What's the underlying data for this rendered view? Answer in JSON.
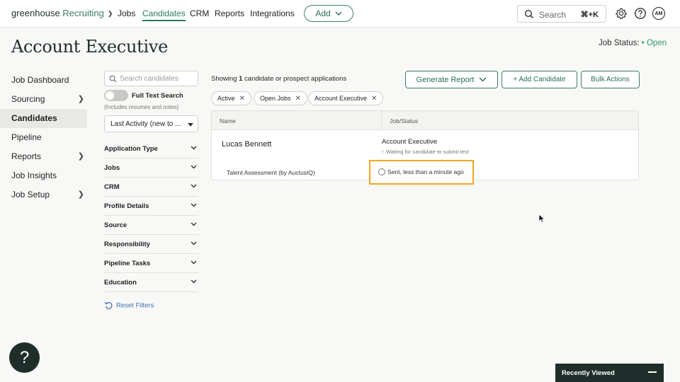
{
  "topnav": {
    "logo_main": "greenhouse",
    "logo_sub": "Recruiting",
    "links": [
      "Jobs",
      "Candidates",
      "CRM",
      "Reports",
      "Integrations"
    ],
    "active_link": "Candidates",
    "add_label": "Add",
    "search_label": "Search",
    "search_shortcut": "⌘+K",
    "avatar_initials": "AM"
  },
  "header": {
    "title": "Account Executive",
    "job_status_label": "Job Status:",
    "job_status_value": "Open"
  },
  "leftnav": {
    "items": [
      {
        "label": "Job Dashboard",
        "has_chevron": false
      },
      {
        "label": "Sourcing",
        "has_chevron": true
      },
      {
        "label": "Candidates",
        "has_chevron": false,
        "active": true
      },
      {
        "label": "Pipeline",
        "has_chevron": false
      },
      {
        "label": "Reports",
        "has_chevron": true
      },
      {
        "label": "Job Insights",
        "has_chevron": false
      },
      {
        "label": "Job Setup",
        "has_chevron": true
      }
    ]
  },
  "filters": {
    "search_placeholder": "Search candidates",
    "full_text_label": "Full Text Search",
    "full_text_note": "(Includes resumes and notes)",
    "sort_value": "Last Activity (new to ...",
    "facets": [
      "Application Type",
      "Jobs",
      "CRM",
      "Profile Details",
      "Source",
      "Responsibility",
      "Pipeline Tasks",
      "Education"
    ],
    "reset_label": "Reset Filters"
  },
  "main": {
    "showing_prefix": "Showing ",
    "showing_count": "1",
    "showing_suffix": " candidate or prospect applications",
    "generate_report": "Generate Report",
    "add_candidate": "+ Add Candidate",
    "bulk_actions": "Bulk Actions",
    "chips": [
      "Active",
      "Open Jobs",
      "Account Executive"
    ],
    "table": {
      "col_name": "Name",
      "col_job": "Job/Status",
      "candidate_name": "Lucas Bennett",
      "job_title": "Account Executive",
      "job_sub": "↑ Waiting for candidate to submit test",
      "assessment": "Talent Assessment (by AuctusIQ)",
      "sent_status": "Sent, less than a minute ago"
    }
  },
  "footer": {
    "help": "?",
    "recently_viewed": "Recently Viewed"
  }
}
